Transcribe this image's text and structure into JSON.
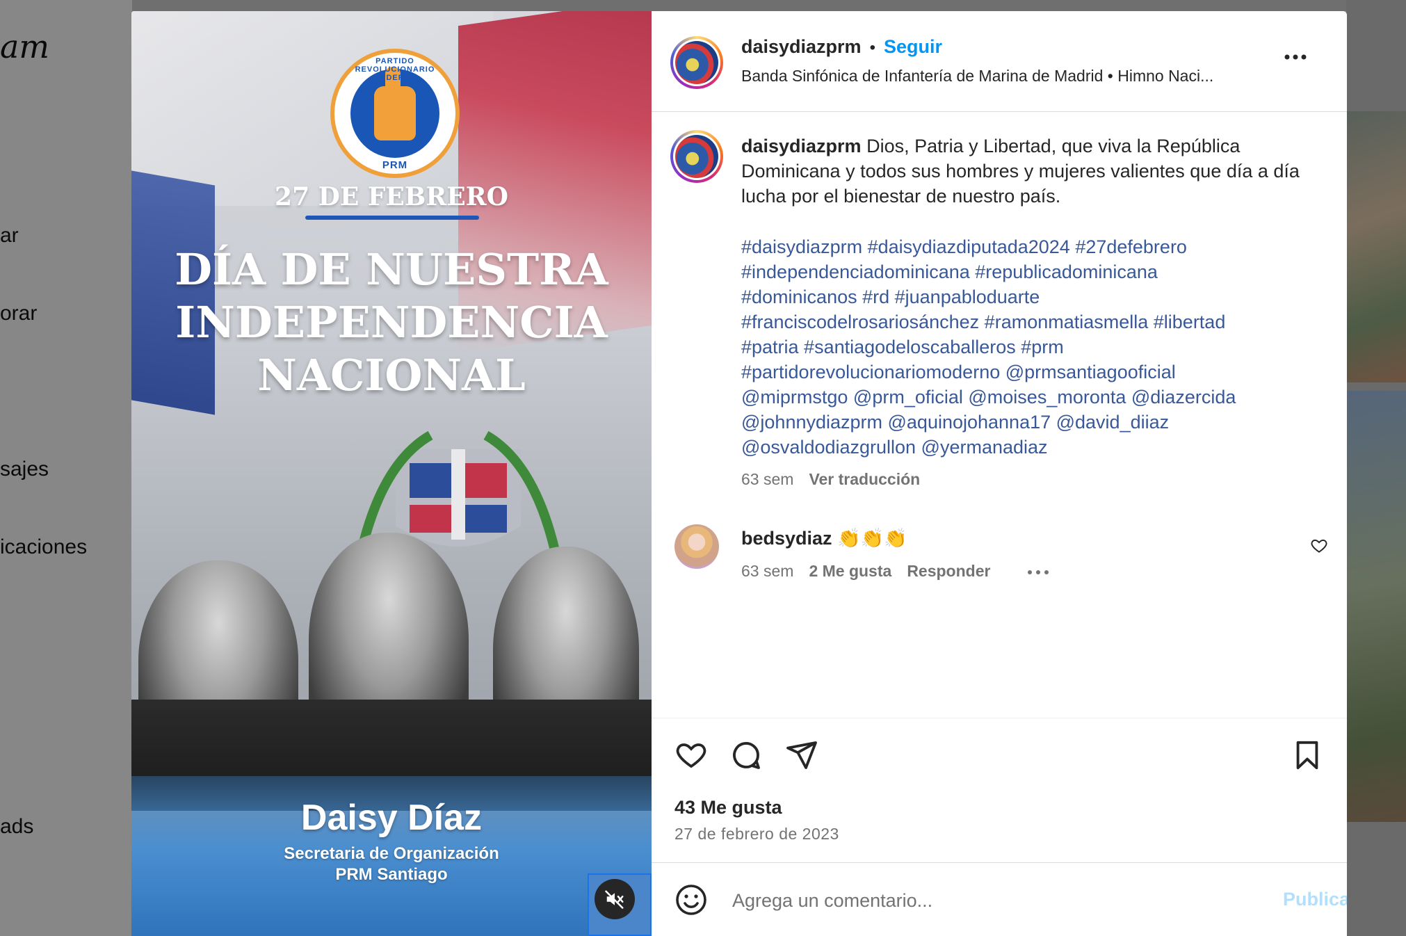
{
  "background": {
    "logo_fragment": "am",
    "nav_fragments": [
      "ar",
      "orar",
      "sajes",
      "icaciones",
      "ads"
    ]
  },
  "post": {
    "media": {
      "party_logo": {
        "top_text": "PARTIDO REVOLUCIONARIO MODERNO",
        "bottom_text": "PRM"
      },
      "date_line": "27 DE FEBRERO",
      "headline": [
        "DÍA DE NUESTRA",
        "INDEPENDENCIA",
        "NACIONAL"
      ],
      "name": "Daisy Díaz",
      "role_line1": "Secretaria de Organización",
      "role_line2": "PRM Santiago",
      "mute_icon": "speaker-muted-icon"
    },
    "header": {
      "username": "daisydiazprm",
      "separator": "•",
      "follow_label": "Seguir",
      "audio_info": "Banda Sinfónica de Infantería de Marina de Madrid • Himno Naci...",
      "more_icon": "more-horizontal-icon"
    },
    "caption": {
      "username": "daisydiazprm",
      "text": "Dios, Patria y Libertad, que viva la República Dominicana y todos sus hombres y mujeres valientes que día a día lucha por el bienestar de nuestro país.",
      "tags_lines": [
        "#daisydiazprm #daisydiazdiputada2024 #27defebrero",
        "#independenciadominicana #republicadominicana",
        "#dominicanos #rd #juanpabloduarte",
        "#franciscodelrosariosánchez #ramonmatiasmella #libertad",
        "#patria #santiagodeloscaballeros #prm",
        "#partidorevolucionariomoderno @prmsantiagooficial",
        "@miprmstgo @prm_oficial @moises_moronta @diazercida",
        "@johnnydiazprm @aquinojohanna17 @david_diiaz",
        "@osvaldodiazgrullon @yermanadiaz"
      ],
      "time": "63 sem",
      "translate_label": "Ver traducción"
    },
    "comment": {
      "username": "bedsydiaz",
      "text": "👏👏👏",
      "time": "63 sem",
      "likes": "2 Me gusta",
      "reply_label": "Responder",
      "more_icon": "more-horizontal-icon",
      "heart_icon": "heart-icon"
    },
    "actions": {
      "like_icon": "heart-icon",
      "comment_icon": "comment-icon",
      "share_icon": "paper-plane-icon",
      "save_icon": "bookmark-icon"
    },
    "likes_count": "43 Me gusta",
    "date": "27 de febrero de 2023",
    "add_comment": {
      "emoji_icon": "smiley-icon",
      "placeholder": "Agrega un comentario...",
      "publish_label": "Publicar"
    }
  },
  "colors": {
    "accent": "#0095f6",
    "hashtag": "#385898",
    "publish_disabled": "#b2dffc"
  }
}
